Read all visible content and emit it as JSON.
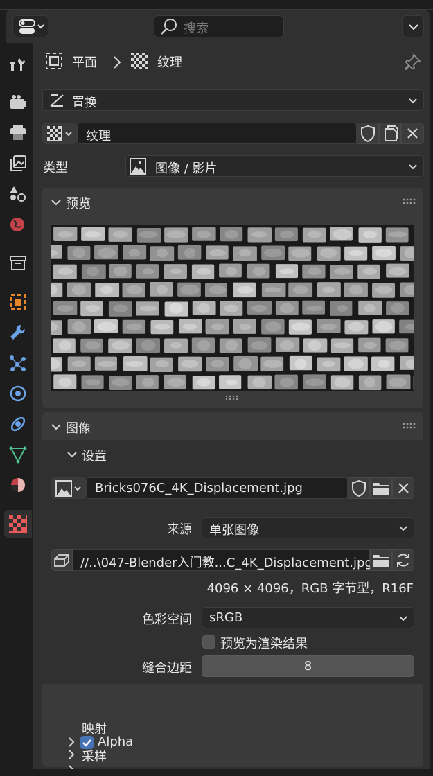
{
  "header": {
    "search_placeholder": "搜索"
  },
  "breadcrumb": {
    "object": "平面",
    "texture": "纹理"
  },
  "modifier": {
    "name": "置换"
  },
  "texture_block": {
    "name": "纹理",
    "type_label": "类型",
    "type_value": "图像 / 影片"
  },
  "preview": {
    "title": "预览"
  },
  "image_panel": {
    "title": "图像",
    "settings_title": "设置",
    "image_name": "Bricks076C_4K_Displacement.jpg",
    "source_label": "来源",
    "source_value": "单张图像",
    "filepath": "//..\\047-Blender入门教...C_4K_Displacement.jpg",
    "info": "4096 × 4096，RGB 字节型，R16F",
    "colorspace_label": "色彩空间",
    "colorspace_value": "sRGB",
    "preview_render_label": "预览为渲染结果",
    "preview_render_checked": false,
    "seam_label": "缝合边距",
    "seam_value": "8"
  },
  "subpanels": {
    "alpha": "Alpha",
    "alpha_checked": true,
    "mapping": "映射",
    "sampling": "采样"
  },
  "colors": {
    "accent_blue": "#4772b3",
    "active_tab_icon": "#e85a5a",
    "object_orange": "#e8862e",
    "modifier_blue": "#6aa3e6",
    "data_green": "#4fc08d"
  }
}
